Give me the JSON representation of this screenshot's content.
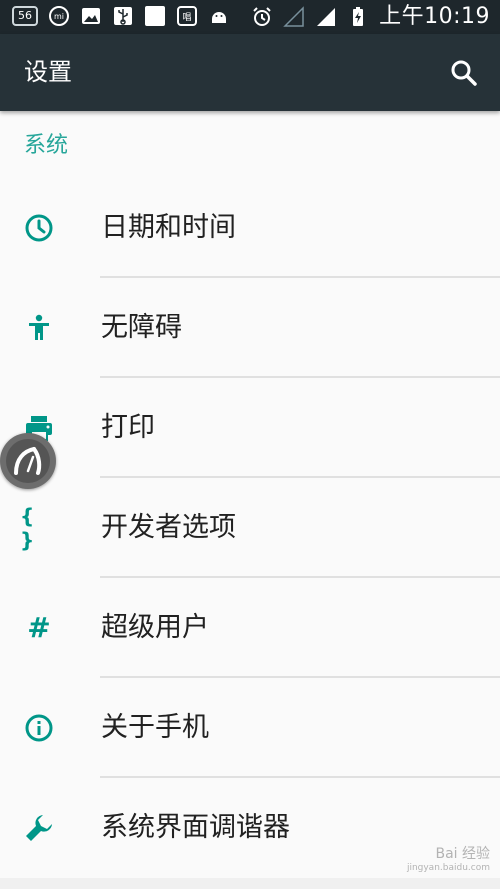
{
  "status_bar": {
    "signal_badge": "56",
    "clock": "上午10:19"
  },
  "toolbar": {
    "title": "设置"
  },
  "section": {
    "title": "系统"
  },
  "items": [
    {
      "label": "日期和时间",
      "icon": "clock-icon"
    },
    {
      "label": "无障碍",
      "icon": "accessibility-icon"
    },
    {
      "label": "打印",
      "icon": "printer-icon"
    },
    {
      "label": "开发者选项",
      "icon": "braces-icon",
      "glyph": "{ }"
    },
    {
      "label": "超级用户",
      "icon": "hash-icon",
      "glyph": "#"
    },
    {
      "label": "关于手机",
      "icon": "info-icon"
    },
    {
      "label": "系统界面调谐器",
      "icon": "wrench-icon"
    }
  ],
  "watermark": {
    "line1": "Bai 经验",
    "line2": "jingyan.baidu.com"
  },
  "colors": {
    "accent": "#009688",
    "section": "#26a69a",
    "toolbar": "#263238",
    "statusbar": "#1e272c"
  }
}
